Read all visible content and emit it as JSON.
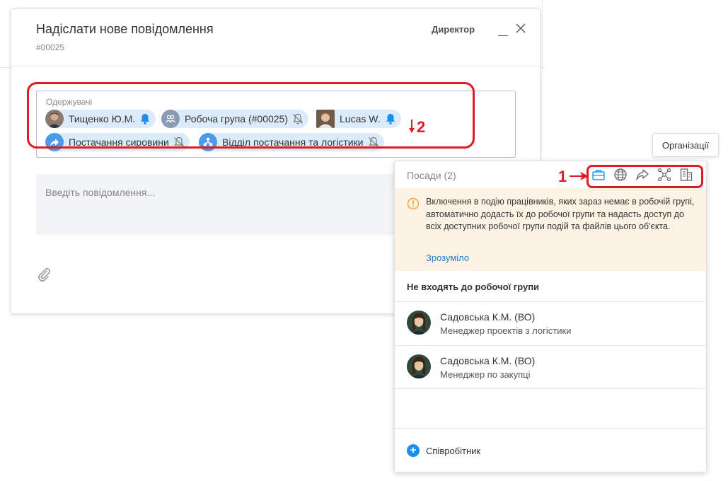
{
  "dialog": {
    "title": "Надіслати нове повідомлення",
    "number": "#00025",
    "role": "Директор"
  },
  "recipients": {
    "label": "Одержувачі",
    "chips": [
      {
        "label": "Тищенко Ю.М.",
        "icon": "user-photo",
        "notify": true
      },
      {
        "label": "Робоча група (#00025)",
        "icon": "group-icon",
        "notify": false
      },
      {
        "label": "Lucas W.",
        "icon": "user-photo",
        "notify": true
      },
      {
        "label": "Постачання сировини",
        "icon": "forward-icon",
        "notify": false
      },
      {
        "label": "Відділ постачання та логістики",
        "icon": "department-icon",
        "notify": false
      }
    ]
  },
  "message": {
    "placeholder": "Введіть повідомлення..."
  },
  "annotations": {
    "mark1": "1",
    "mark2": "2",
    "color": "#e11b22"
  },
  "tooltip": {
    "text": "Організації"
  },
  "panel": {
    "header": "Посади (2)",
    "tools": [
      "briefcase-icon",
      "globe-icon",
      "share-icon",
      "network-icon",
      "document-icon"
    ],
    "warning": {
      "text": "Включення в подію працівників, яких зараз немає в робочій групі, автоматично додасть їх до робочої групи та надасть доступ до всіх доступних робочої групи подій та файлів цього об'єкта.",
      "link": "Зрозуміло"
    },
    "section_title": "Не входять до робочої групи",
    "people": [
      {
        "name": "Садовська К.М. (ВО)",
        "role": "Менеджер проектів з логістики"
      },
      {
        "name": "Садовська К.М. (ВО)",
        "role": "Менеджер по закупці"
      }
    ],
    "add_label": "Співробітник"
  },
  "colors": {
    "accent": "#1a8ff0",
    "chip_bg": "#dcebf9",
    "warning_bg": "#fdf3e5",
    "warning_icon": "#f0a030"
  }
}
